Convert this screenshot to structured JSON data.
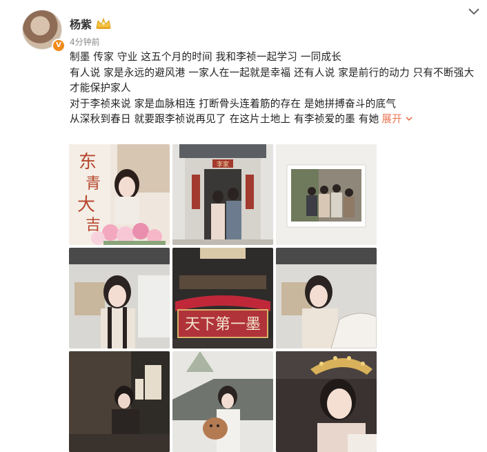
{
  "user": {
    "name": "杨紫",
    "time": "4分钟前",
    "verified_badge": "V",
    "icons": [
      "avatar",
      "crown-icon",
      "verified-icon",
      "chevron-down-icon"
    ]
  },
  "post": {
    "lines": [
      "制墨 传家 守业 这五个月的时间 我和李祯一起学习 一同成长",
      "有人说 家是永远的避风港 一家人在一起就是幸福 还有人说 家是前行的动力 只有不断强大才能保护家人",
      "对于李祯来说 家是血脉相连 打断骨头连着筋的存在 是她拼搏奋斗的底气",
      "从深秋到春日 就要跟李祯说再见了 在这片土地上 有李祯爱的墨 有她"
    ],
    "expand_label": "展开"
  },
  "photos": {
    "poster_text": "东青大吉",
    "plaque_text": "天下第一墨",
    "gate_sign": "李家",
    "colors": {
      "orange": "#eb7350",
      "verified": "#f28a1b",
      "plaque_red": "#b1333a"
    }
  }
}
